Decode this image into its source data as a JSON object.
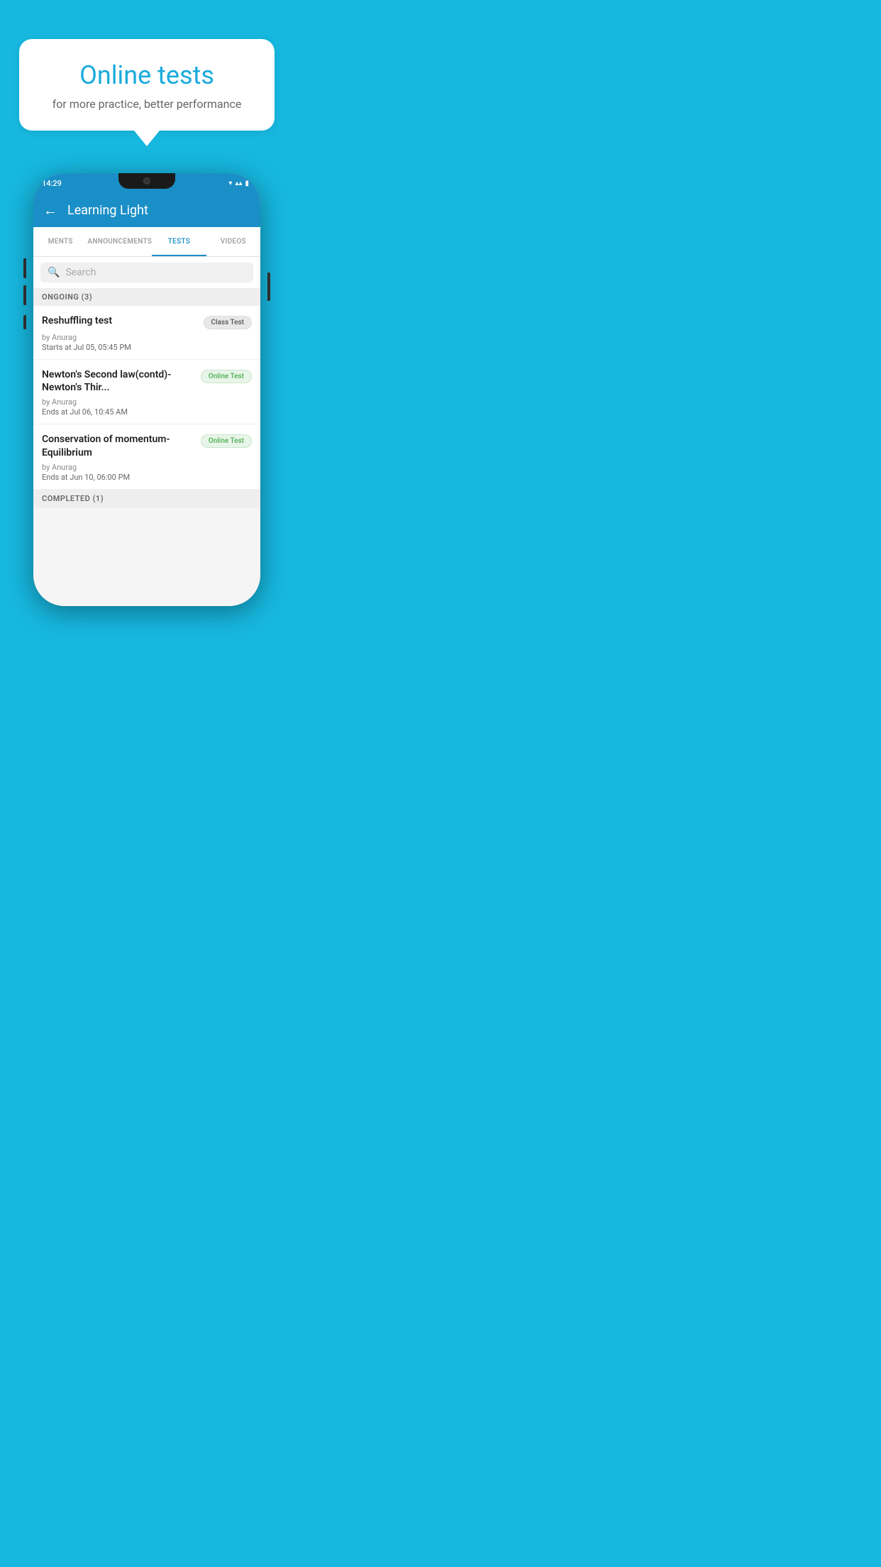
{
  "bubble": {
    "title": "Online tests",
    "subtitle": "for more practice, better performance"
  },
  "status_bar": {
    "time": "14:29",
    "icons": "▾◂▮"
  },
  "app_bar": {
    "title": "Learning Light",
    "back_label": "←"
  },
  "tabs": [
    {
      "label": "MENTS",
      "active": false
    },
    {
      "label": "ANNOUNCEMENTS",
      "active": false
    },
    {
      "label": "TESTS",
      "active": true
    },
    {
      "label": "VIDEOS",
      "active": false
    }
  ],
  "search": {
    "placeholder": "Search"
  },
  "ongoing_section": {
    "label": "ONGOING (3)"
  },
  "tests": [
    {
      "name": "Reshuffling test",
      "badge": "Class Test",
      "badge_type": "class",
      "meta_by": "by Anurag",
      "meta_time_label": "Starts at",
      "meta_time": "Jul 05, 05:45 PM"
    },
    {
      "name": "Newton's Second law(contd)-Newton's Thir...",
      "badge": "Online Test",
      "badge_type": "online",
      "meta_by": "by Anurag",
      "meta_time_label": "Ends at",
      "meta_time": "Jul 06, 10:45 AM"
    },
    {
      "name": "Conservation of momentum-Equilibrium",
      "badge": "Online Test",
      "badge_type": "online",
      "meta_by": "by Anurag",
      "meta_time_label": "Ends at",
      "meta_time": "Jun 10, 06:00 PM"
    }
  ],
  "completed_section": {
    "label": "COMPLETED (1)"
  }
}
